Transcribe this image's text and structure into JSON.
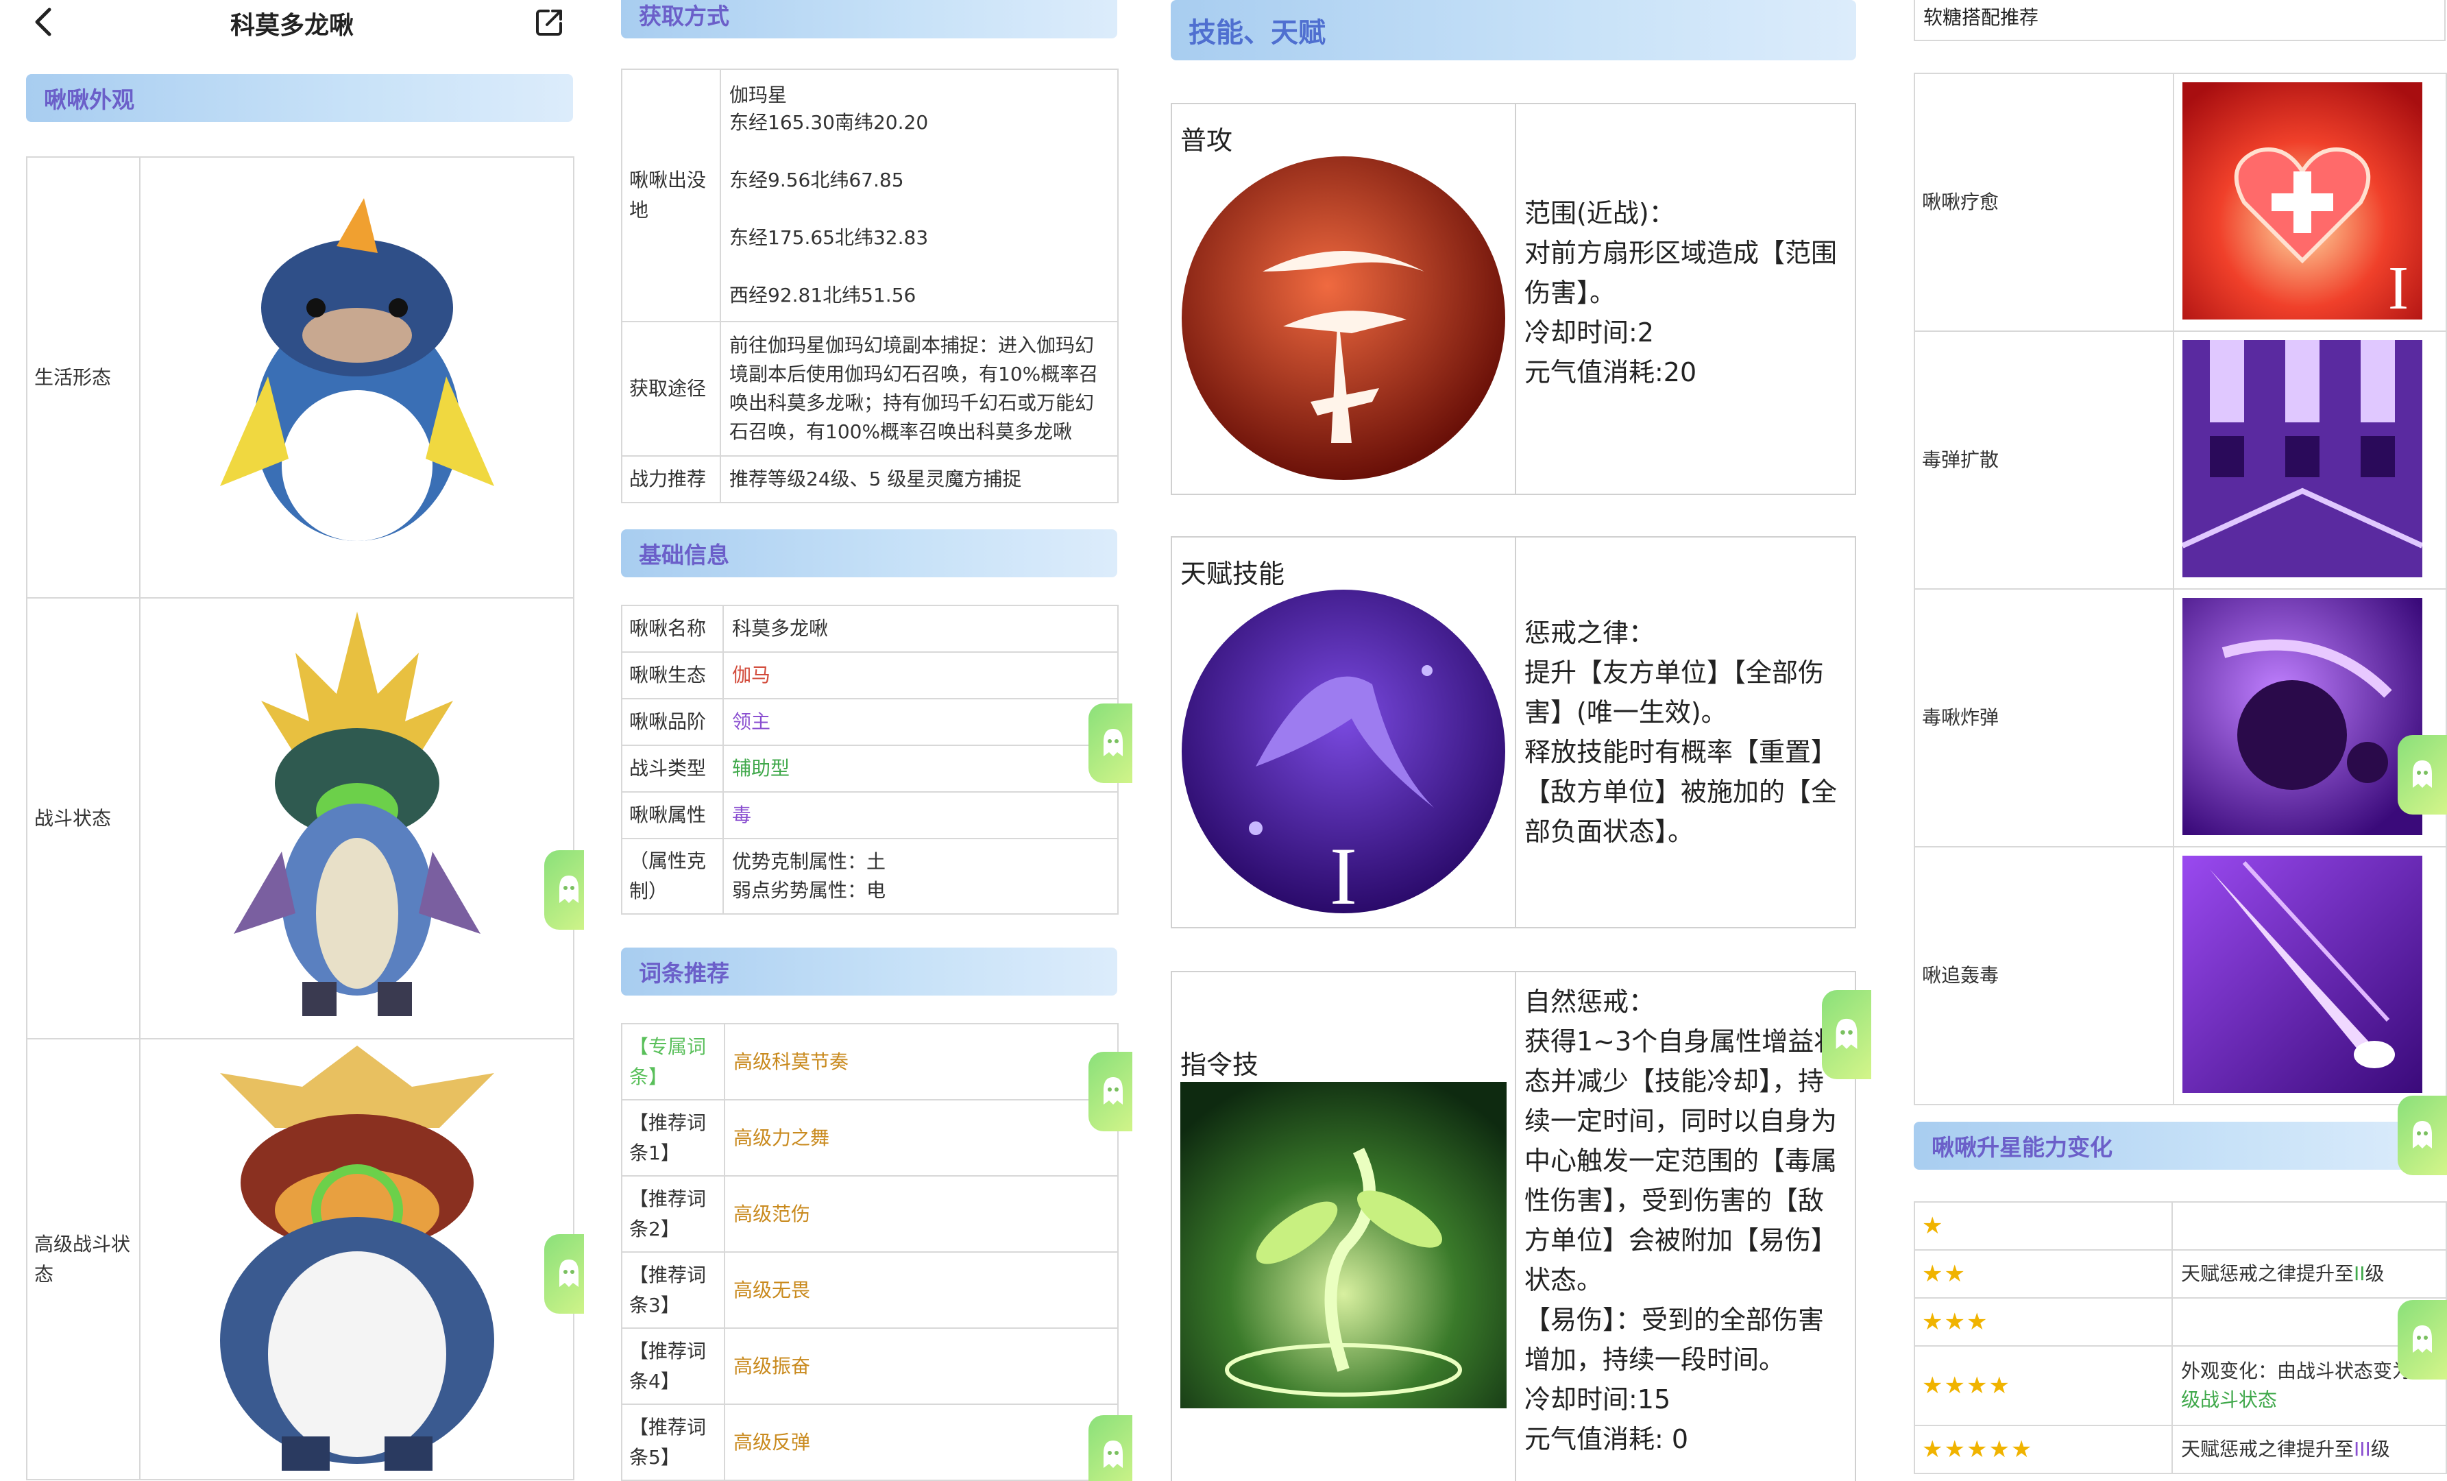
{
  "app": {
    "title": "科莫多龙啾"
  },
  "panel1": {
    "appearance_header": "啾啾外观",
    "forms": [
      {
        "label": "生活形态"
      },
      {
        "label": "战斗状态"
      },
      {
        "label": "高级战斗状态"
      }
    ]
  },
  "panel2": {
    "acquire_header": "获取方式",
    "spawn_label": "啾啾出没地",
    "spawn_lines": [
      "伽玛星",
      "东经165.30南纬20.20",
      "东经9.56北纬67.85",
      "东经175.65北纬32.83",
      "西经92.81北纬51.56"
    ],
    "route_label": "获取途径",
    "route_text": "前往伽玛星伽玛幻境副本捕捉：进入伽玛幻境副本后使用伽玛幻石召唤，有10%概率召唤出科莫多龙啾；持有伽玛千幻石或万能幻石召唤，有100%概率召唤出科莫多龙啾",
    "power_label": "战力推荐",
    "power_text": "推荐等级24级、5 级星灵魔方捕捉",
    "basic_header": "基础信息",
    "basic_rows": [
      {
        "label": "啾啾名称",
        "value": "科莫多龙啾"
      },
      {
        "label": "啾啾生态",
        "value": "伽马"
      },
      {
        "label": "啾啾品阶",
        "value": "领主"
      },
      {
        "label": "战斗类型",
        "value": "辅助型"
      },
      {
        "label": "啾啾属性",
        "value": "毒"
      }
    ],
    "attr_label": "（属性克制）",
    "attr_lines": [
      "优势克制属性：土",
      "弱点劣势属性：电"
    ],
    "entries_header": "词条推荐",
    "entries": [
      {
        "label": "【专属词条】",
        "value": "高级科莫节奏"
      },
      {
        "label": "【推荐词条1】",
        "value": "高级力之舞"
      },
      {
        "label": "【推荐词条2】",
        "value": "高级范伤"
      },
      {
        "label": "【推荐词条3】",
        "value": "高级无畏"
      },
      {
        "label": "【推荐词条4】",
        "value": "高级振奋"
      },
      {
        "label": "【推荐词条5】",
        "value": "高级反弹"
      }
    ]
  },
  "panel3": {
    "header": "技能、天赋",
    "skills": [
      {
        "title": "普攻",
        "text": "范围(近战)：\n对前方扇形区域造成【范围伤害】。\n冷却时间:2\n元气值消耗:20"
      },
      {
        "title": "天赋技能",
        "text": "惩戒之律：\n提升【友方单位】【全部伤害】(唯一生效)。\n释放技能时有概率【重置】【敌方单位】被施加的【全部负面状态】。"
      },
      {
        "title": "指令技",
        "text": "自然惩戒：\n获得1~3个自身属性增益状态并减少【技能冷却】，持续一定时间，同时以自身为中心触发一定范围的【毒属性伤害】，受到伤害的【敌方单位】会被附加【易伤】状态。\n【易伤】：受到的全部伤害增加，持续一段时间。\n冷却时间:15\n元气值消耗: 0"
      }
    ]
  },
  "panel4": {
    "candy_header": "软糖搭配推荐",
    "candies": [
      {
        "label": "啾啾疗愈"
      },
      {
        "label": "毒弹扩散"
      },
      {
        "label": "毒啾炸弹"
      },
      {
        "label": "啾追轰毒"
      }
    ],
    "star_header": "啾啾升星能力变化",
    "star_rows": [
      {
        "stars": "★",
        "text": ""
      },
      {
        "stars": "★★",
        "text_a": "天赋惩戒之律提升至",
        "hl": "II",
        "text_b": "级"
      },
      {
        "stars": "★★★",
        "text": ""
      },
      {
        "stars": "★★★★",
        "text_a": "外观变化：由战斗状态变为",
        "hl": "高级战斗状态",
        "text_b": ""
      },
      {
        "stars": "★★★★★",
        "text_a": "天赋惩戒之律提升至",
        "hl": "III",
        "text_b": "级"
      }
    ]
  },
  "colors": {
    "header_bg": "#a8cdf0",
    "header_text": "#6b5fc9",
    "accent_red": "#d24a3a",
    "accent_purple": "#8a4fd0",
    "accent_green": "#3fa84a",
    "accent_orange": "#c98a1e"
  }
}
